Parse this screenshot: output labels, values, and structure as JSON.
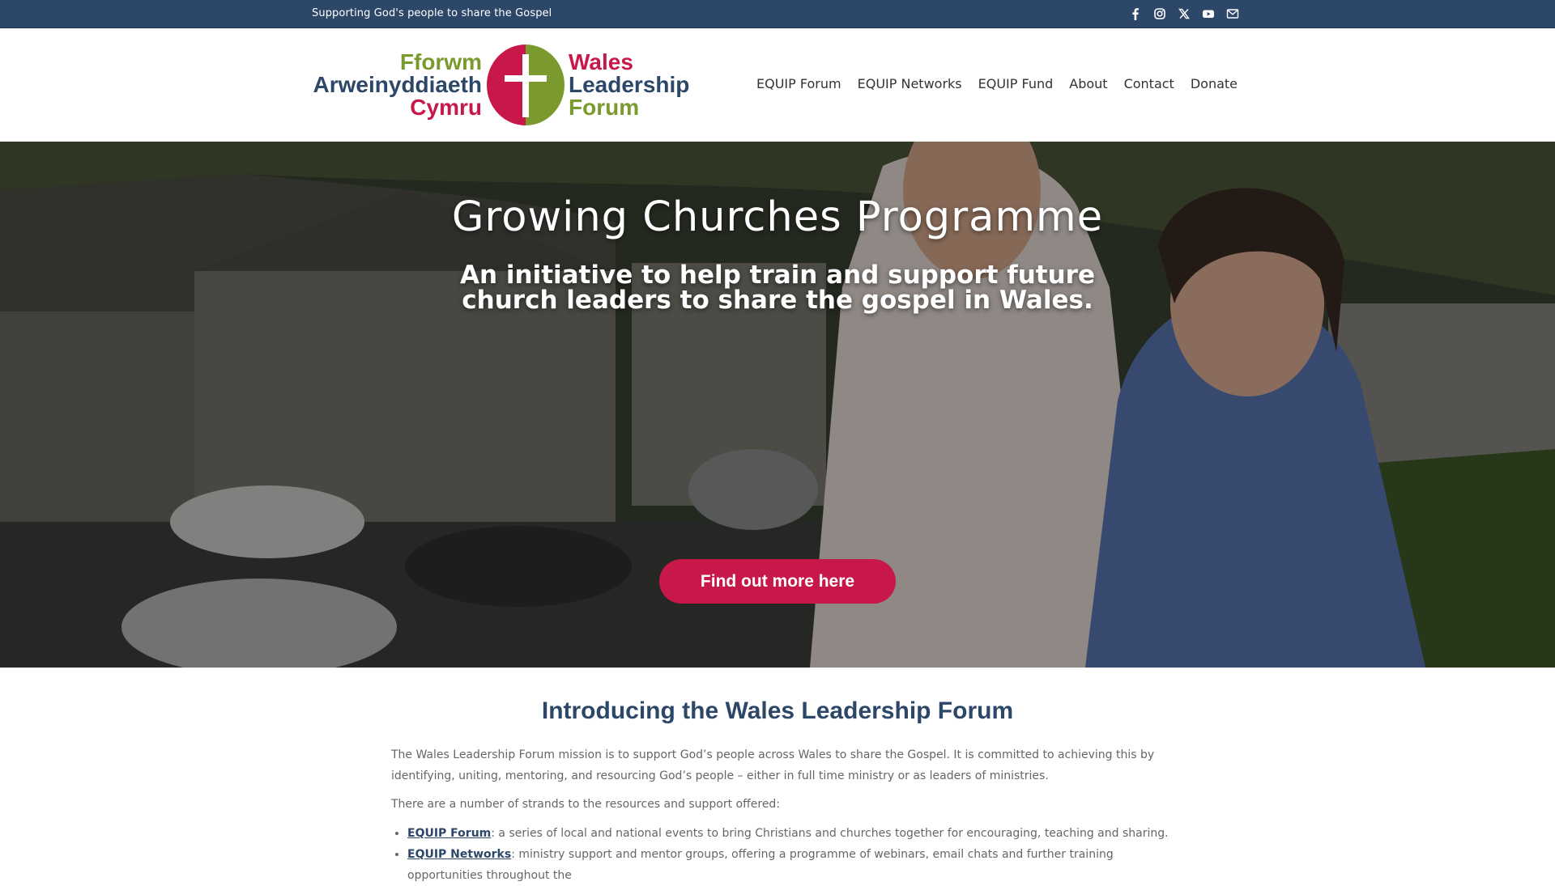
{
  "topbar": {
    "tagline": "Supporting God's people to share the Gospel",
    "social": [
      "facebook-icon",
      "instagram-icon",
      "x-icon",
      "youtube-icon",
      "email-icon"
    ]
  },
  "logo": {
    "welsh_line1": "Fforwm",
    "welsh_line2": "Arweinyddiaeth",
    "welsh_line3": "Cymru",
    "english_line1": "Wales",
    "english_line2": "Leadership",
    "english_line3": "Forum",
    "colors": {
      "green": "#7a9a2e",
      "navy": "#2d4768",
      "crimson": "#c8184a"
    }
  },
  "nav": {
    "items": [
      "EQUIP Forum",
      "EQUIP Networks",
      "EQUIP Fund",
      "About",
      "Contact",
      "Donate"
    ]
  },
  "hero": {
    "title": "Growing Churches Programme",
    "subtitle": "An initiative to help train and support future church leaders to share the gospel in Wales.",
    "cta_label": "Find out more here",
    "cta_color": "#c8184a"
  },
  "intro": {
    "heading": "Introducing the Wales Leadership Forum",
    "paragraph1": "The Wales Leadership Forum mission is to support God’s people across Wales to share the Gospel. It is committed to achieving this by identifying, uniting, mentoring, and resourcing God’s people – either in full time ministry or as leaders of ministries.",
    "paragraph2": "There are a number of strands to the resources and support offered:",
    "strands": [
      {
        "link": "EQUIP Forum",
        "text": ": a series of local and national events to bring Christians and churches together for encouraging, teaching and sharing."
      },
      {
        "link": "EQUIP Networks",
        "text": ": ministry support and mentor groups, offering a programme of webinars, email chats and further training opportunities throughout the"
      }
    ]
  }
}
